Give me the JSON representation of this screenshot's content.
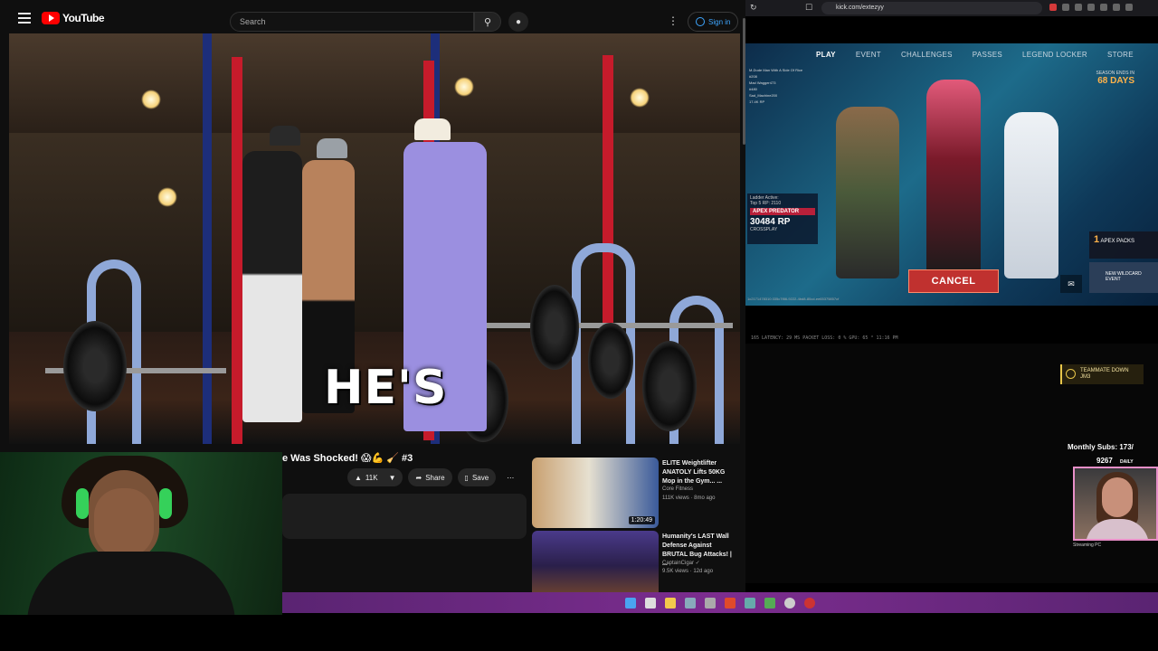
{
  "youtube": {
    "logo_text": "YouTube",
    "search_placeholder": "Search",
    "signin_label": "Sign in",
    "video_caption": "HE'S",
    "video_title": "e Was Shocked! 😱💪 🧹 #3",
    "like_count": "11K",
    "share_label": "Share",
    "save_label": "Save",
    "recommendations": [
      {
        "title": "ELITE Weightlifter ANATOLY Lifts 50KG Mop in the Gym... ...",
        "channel": "Core Fitness",
        "meta": "111K views · 8mo ago",
        "duration": "1:20:49"
      },
      {
        "title": "Humanity's LAST Wall Defense Against BRUTAL Bug Attacks! | ...",
        "channel": "CaptainCigar ✓",
        "meta": "9.5K views · 12d ago",
        "duration": ""
      }
    ]
  },
  "browser": {
    "url": "kick.com/extezyy"
  },
  "game": {
    "nav": [
      "PLAY",
      "EVENT",
      "CHALLENGES",
      "PASSES",
      "LEGEND LOCKER",
      "STORE"
    ],
    "active_nav": "PLAY",
    "season_label": "SEASON ENDS IN",
    "season_days": "68 DAYS",
    "ladder_label": "Ladder Active:",
    "ladder_top": "Top 5 RP: 2110",
    "rank": "APEX PREDATOR",
    "rp": "30484 RP",
    "crossplay": "CROSSPLAY",
    "cancel_label": "CANCEL",
    "packs_count": "1",
    "packs_label": "APEX PACKS",
    "wildcard_label": "NEW WILDCARD EVENT",
    "uid": "1c2171478310:335c7f86-9222-4bd8-80cd-ee65375857cf",
    "squad": [
      "M-Dude Man With A Side Of Rice",
      "#208",
      "Mad Wagger473",
      "#480",
      "Sad_Machine200",
      "17.4K RP"
    ]
  },
  "stream": {
    "stats": "165 LATENCY: 29 MS  PACKET LOSS: 0 %  GPU: 65 °  11:16 PM",
    "teammate_down": "TEAMMATE DOWN",
    "teammate_name": "JM3",
    "monthly_subs": "Monthly Subs: 173/",
    "sub_count": "9267",
    "sub_daily": "DAILY",
    "streaming_pc": "Streaming PC"
  },
  "colors": {
    "youtube_red": "#ff0000",
    "taskbar_purple": "#7c2d8f",
    "cancel_red": "#c0312f",
    "predator_red": "#b8203a",
    "headphone_green": "#35d15a"
  }
}
